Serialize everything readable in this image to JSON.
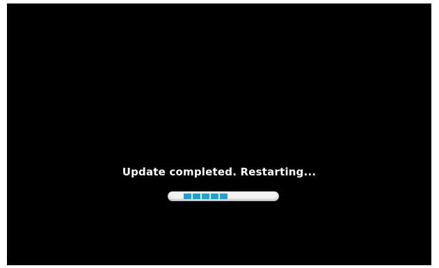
{
  "status": {
    "message": "Update completed. Restarting..."
  },
  "progress": {
    "active_segments": 5,
    "accent_color": "#1ba3d6",
    "track_color": "#f2f2f2",
    "background_color": "#000000"
  }
}
